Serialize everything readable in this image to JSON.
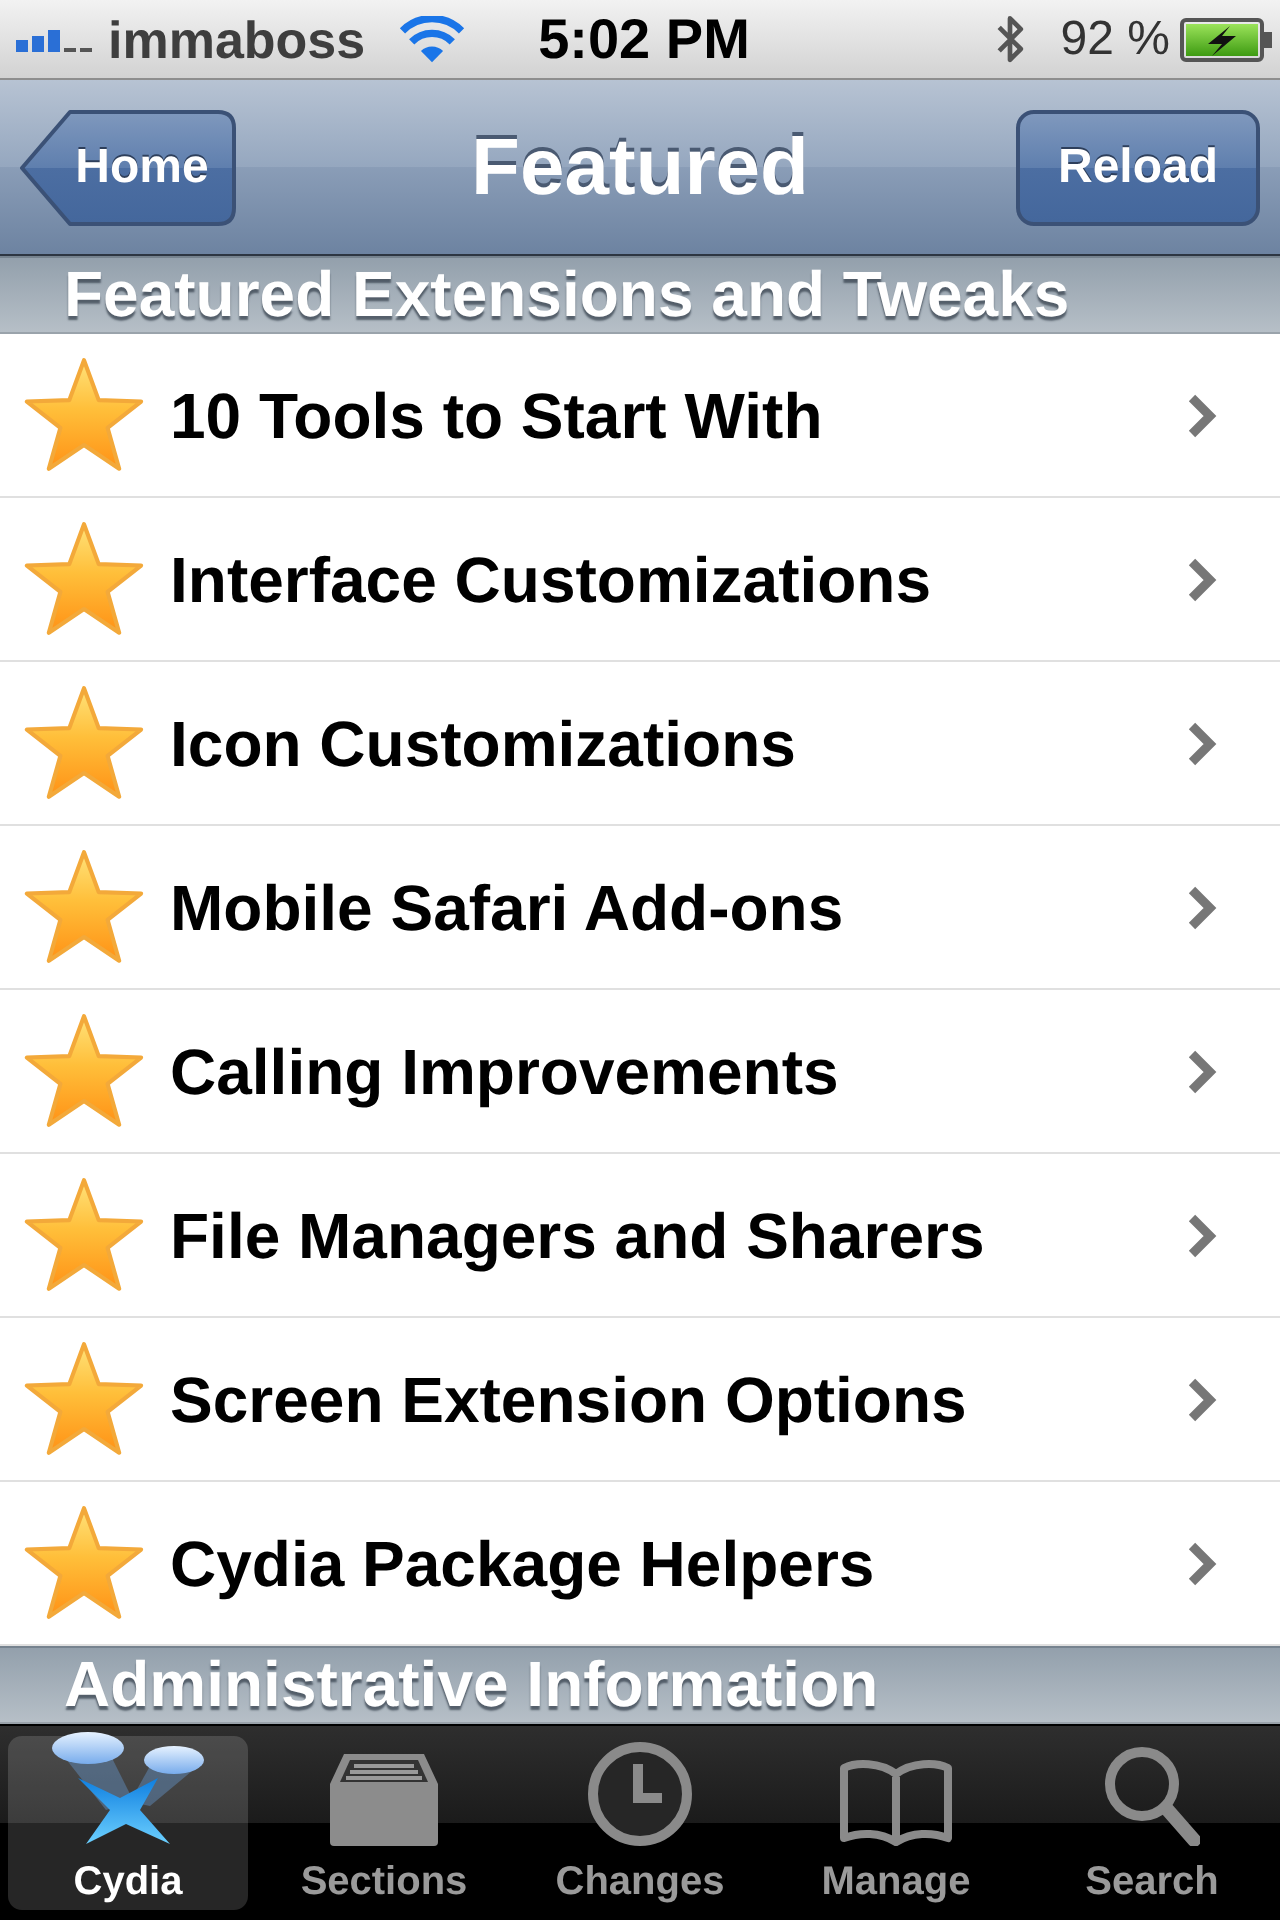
{
  "status_bar": {
    "carrier": "immaboss",
    "time": "5:02 PM",
    "battery_percent": "92 %"
  },
  "navigation_bar": {
    "back_button": "Home",
    "title": "Featured",
    "right_button": "Reload"
  },
  "sections": [
    {
      "header": "Featured Extensions and Tweaks",
      "items": [
        {
          "label": "10 Tools to Start With"
        },
        {
          "label": "Interface Customizations"
        },
        {
          "label": "Icon Customizations"
        },
        {
          "label": "Mobile Safari Add-ons"
        },
        {
          "label": "Calling Improvements"
        },
        {
          "label": "File Managers and Sharers"
        },
        {
          "label": "Screen Extension Options"
        },
        {
          "label": "Cydia Package Helpers"
        }
      ]
    },
    {
      "header": "Administrative Information"
    }
  ],
  "tab_bar": [
    {
      "label": "Cydia",
      "selected": true
    },
    {
      "label": "Sections",
      "selected": false
    },
    {
      "label": "Changes",
      "selected": false
    },
    {
      "label": "Manage",
      "selected": false
    },
    {
      "label": "Search",
      "selected": false
    }
  ]
}
